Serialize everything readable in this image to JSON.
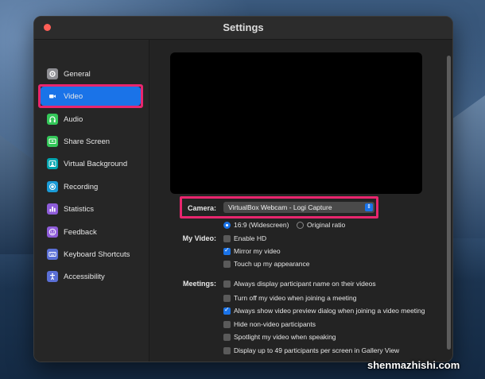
{
  "window": {
    "title": "Settings"
  },
  "sidebar": {
    "items": [
      {
        "label": "General",
        "icon": "gear-icon",
        "color": "#8e8e93"
      },
      {
        "label": "Video",
        "icon": "video-camera-icon",
        "color": "#1a73e8",
        "selected": true
      },
      {
        "label": "Audio",
        "icon": "headphones-icon",
        "color": "#34c759"
      },
      {
        "label": "Share Screen",
        "icon": "share-screen-icon",
        "color": "#34c759"
      },
      {
        "label": "Virtual Background",
        "icon": "person-icon",
        "color": "#00a5b0"
      },
      {
        "label": "Recording",
        "icon": "record-icon",
        "color": "#1a9bd7"
      },
      {
        "label": "Statistics",
        "icon": "chart-icon",
        "color": "#8e5cd9"
      },
      {
        "label": "Feedback",
        "icon": "smiley-icon",
        "color": "#8e5cd9"
      },
      {
        "label": "Keyboard Shortcuts",
        "icon": "keyboard-icon",
        "color": "#5a6fd6"
      },
      {
        "label": "Accessibility",
        "icon": "accessibility-icon",
        "color": "#5a6fd6"
      }
    ]
  },
  "video": {
    "camera_label": "Camera:",
    "camera_value": "VirtualBox Webcam - Logi Capture",
    "ratio_options": [
      {
        "label": "16:9 (Widescreen)",
        "selected": true
      },
      {
        "label": "Original ratio",
        "selected": false
      }
    ],
    "my_video_label": "My Video:",
    "my_video_options": [
      {
        "label": "Enable HD",
        "checked": false
      },
      {
        "label": "Mirror my video",
        "checked": true
      },
      {
        "label": "Touch up my appearance",
        "checked": false
      }
    ],
    "meetings_label": "Meetings:",
    "meetings_options": [
      {
        "label": "Always display participant name on their videos",
        "checked": false
      },
      {
        "label": "Turn off my video when joining a meeting",
        "checked": false
      },
      {
        "label": "Always show video preview dialog when joining a video meeting",
        "checked": true
      },
      {
        "label": "Hide non-video participants",
        "checked": false
      },
      {
        "label": "Spotlight my video when speaking",
        "checked": false
      },
      {
        "label": "Display up to 49 participants per screen in Gallery View",
        "checked": false
      }
    ]
  },
  "colors": {
    "accent": "#1a73e8",
    "highlight": "#e8266e"
  },
  "watermark": "shenmazhishi.com"
}
